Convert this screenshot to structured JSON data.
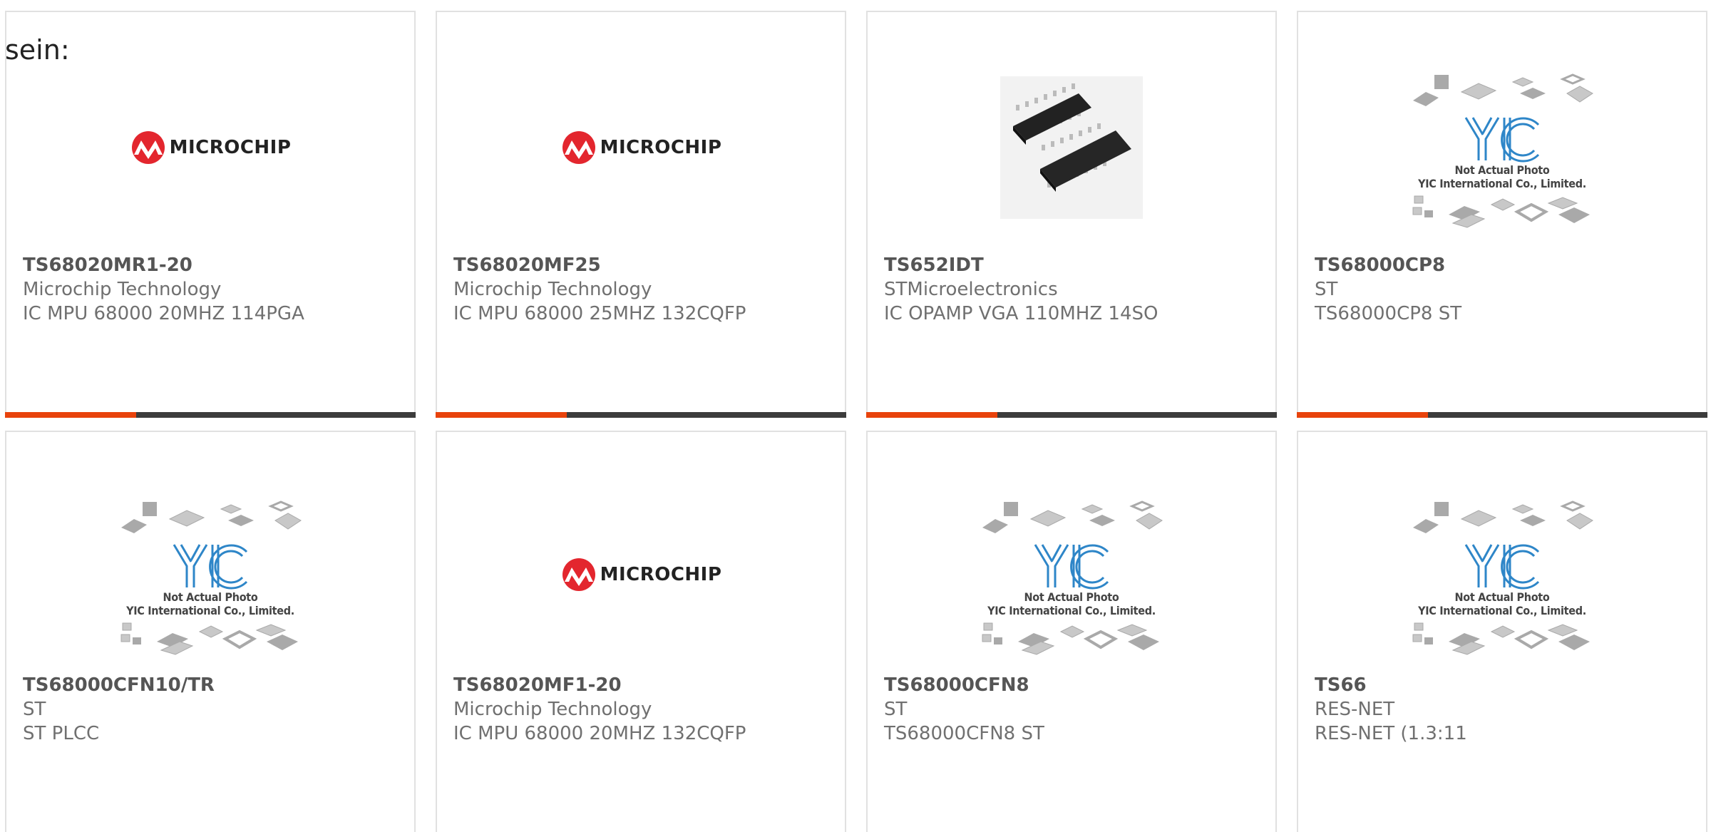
{
  "intro_text": "sein:",
  "colors": {
    "accent": "#e8430c",
    "bar_dark": "#3c3c3c",
    "border": "#e1e1e1",
    "microchip_red": "#e3262e",
    "yic_blue": "#2e86c8"
  },
  "products": [
    {
      "part": "TS68020MR1-20",
      "manufacturer": "Microchip Technology",
      "description": "IC MPU 68000 20MHZ 114PGA",
      "image": "microchip-logo",
      "progress": 0.32
    },
    {
      "part": "TS68020MF25",
      "manufacturer": "Microchip Technology",
      "description": "IC MPU 68000 25MHZ 132CQFP",
      "image": "microchip-logo",
      "progress": 0.32
    },
    {
      "part": "TS652IDT",
      "manufacturer": "STMicroelectronics",
      "description": "IC OPAMP VGA 110MHZ 14SO",
      "image": "soic-chip-photo",
      "progress": 0.32
    },
    {
      "part": "TS68000CP8",
      "manufacturer": "ST",
      "description": "TS68000CP8 ST",
      "image": "yic-placeholder",
      "progress": 0.32
    },
    {
      "part": "TS68000CFN10/TR",
      "manufacturer": "ST",
      "description": "ST PLCC",
      "image": "yic-placeholder"
    },
    {
      "part": "TS68020MF1-20",
      "manufacturer": "Microchip Technology",
      "description": "IC MPU 68000 20MHZ 132CQFP",
      "image": "microchip-logo"
    },
    {
      "part": "TS68000CFN8",
      "manufacturer": "ST",
      "description": "TS68000CFN8 ST",
      "image": "yic-placeholder"
    },
    {
      "part": "TS66",
      "manufacturer": "RES-NET",
      "description": "RES-NET (1.3:11",
      "image": "yic-placeholder"
    }
  ],
  "logos": {
    "microchip_text": "Microchip",
    "yic_mark": "YIC",
    "placeholder_line1": "Not Actual Photo",
    "placeholder_line2": "YIC International Co., Limited."
  }
}
